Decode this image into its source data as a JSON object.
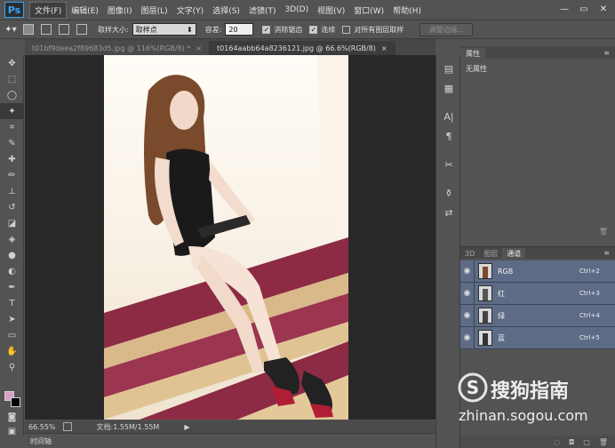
{
  "app": {
    "logo": "Ps"
  },
  "menu": [
    "文件(F)",
    "编辑(E)",
    "图像(I)",
    "图层(L)",
    "文字(Y)",
    "选择(S)",
    "滤镜(T)",
    "3D(D)",
    "视图(V)",
    "窗口(W)",
    "帮助(H)"
  ],
  "window_controls": {
    "minimize": "—",
    "restore": "▭",
    "close": "✕"
  },
  "options": {
    "sample_size_label": "取样大小:",
    "sample_size_value": "取样点",
    "tolerance_label": "容差:",
    "tolerance_value": "20",
    "antialias_label": "消除锯齿",
    "contiguous_label": "连续",
    "all_layers_label": "对所有图层取样",
    "refine_edge_label": "调整边缘..."
  },
  "tabs": [
    {
      "label": "t01bf9deea2f89683d5.jpg @ 116%(RGB/8) *",
      "close": "×"
    },
    {
      "label": "t0164aabb64a8236121.jpg @ 66.6%(RGB/8)",
      "close": "×"
    }
  ],
  "status": {
    "zoom": "66.55%",
    "doc_info": "文档:1.55M/1.55M",
    "arrow": "▶"
  },
  "timeline": {
    "label": "时间轴"
  },
  "properties": {
    "tab": "属性",
    "body": "无属性"
  },
  "layers_tabs": [
    "3D",
    "图层",
    "通道"
  ],
  "channels": [
    {
      "name": "RGB",
      "shortcut": "Ctrl+2"
    },
    {
      "name": "红",
      "shortcut": "Ctrl+3"
    },
    {
      "name": "绿",
      "shortcut": "Ctrl+4"
    },
    {
      "name": "蓝",
      "shortcut": "Ctrl+5"
    }
  ],
  "watermark": {
    "brand": "搜狗指南",
    "url": "zhinan.sogou.com"
  },
  "colors": {
    "foreground": "#d8a0c8",
    "background": "#000000",
    "accent": "#5e6b86"
  }
}
